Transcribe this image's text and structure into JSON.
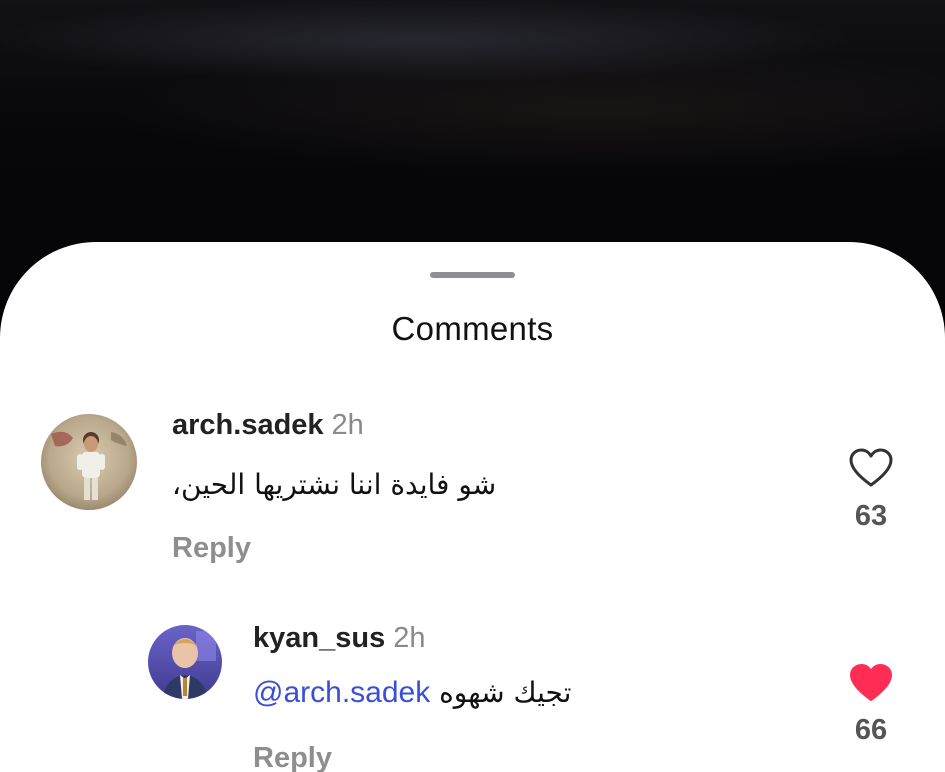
{
  "sheet": {
    "title": "Comments"
  },
  "comments": [
    {
      "username": "arch.sadek",
      "time": "2h",
      "text": "شو فايدة اننا نشتريها الحين،",
      "reply_label": "Reply",
      "likes": "63",
      "liked": false
    },
    {
      "username": "kyan_sus",
      "time": "2h",
      "mention": "@arch.sadek",
      "text": "تجيك شهوه",
      "reply_label": "Reply",
      "likes": "66",
      "liked": true
    }
  ],
  "icons": {
    "like_outline": "heart-outline-icon",
    "like_filled": "heart-filled-icon"
  },
  "colors": {
    "heart_liked": "#ff2d55",
    "mention": "#3a4fd6"
  }
}
